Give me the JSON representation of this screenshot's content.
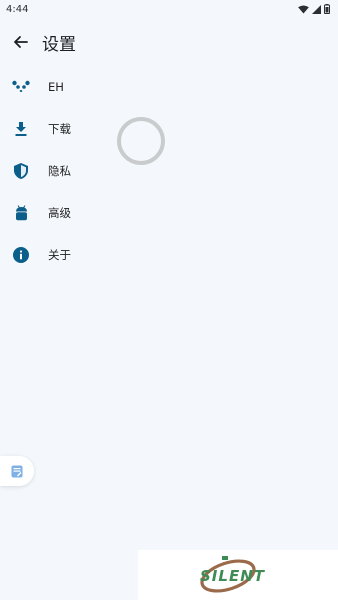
{
  "status_bar": {
    "time": "4:44",
    "icons": [
      "wifi-icon",
      "signal-icon",
      "battery-icon"
    ]
  },
  "app_bar": {
    "back_icon": "arrow-back-icon",
    "title": "设置"
  },
  "settings": {
    "items": [
      {
        "label": "EH",
        "icon": "panda-icon"
      },
      {
        "label": "下载",
        "icon": "download-icon"
      },
      {
        "label": "隐私",
        "icon": "shield-icon"
      },
      {
        "label": "高级",
        "icon": "android-icon"
      },
      {
        "label": "关于",
        "icon": "info-icon"
      }
    ]
  },
  "colors": {
    "background": "#f4f8fc",
    "icon_accent": "#0b5f8a",
    "spinner": "#c9cbcd",
    "watermark": "#3f8b55"
  },
  "watermark": {
    "text": "SILENT"
  }
}
